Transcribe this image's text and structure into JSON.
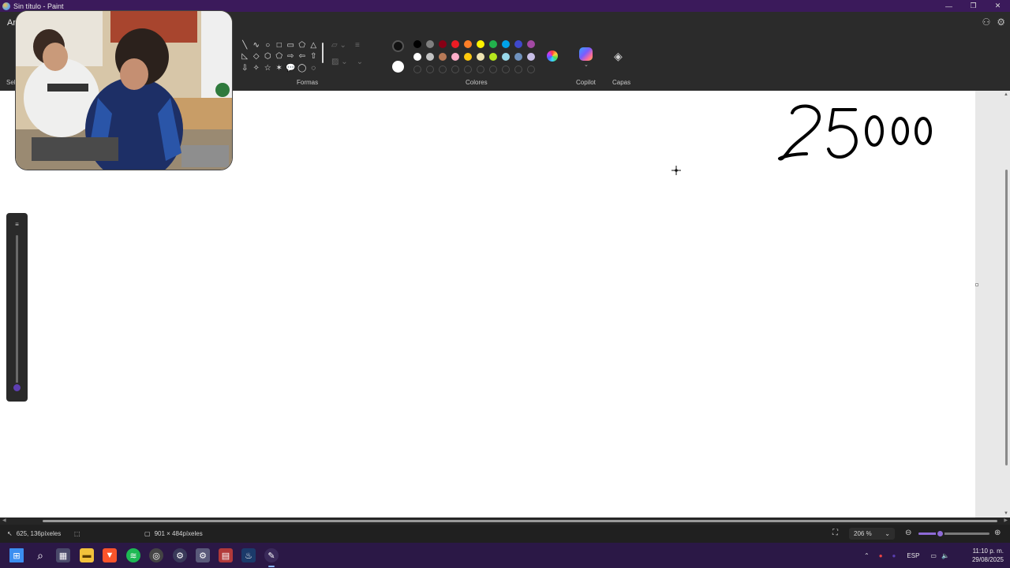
{
  "window": {
    "title": "Sin título - Paint",
    "controls": {
      "minimize": "—",
      "maximize": "❐",
      "close": "✕"
    }
  },
  "menu": {
    "file_label": "Arch",
    "icons": [
      "copilot-account-icon",
      "settings-icon"
    ]
  },
  "ribbon": {
    "select_label": "Sel",
    "shapes_label": "Formas",
    "colors_label": "Colores",
    "copilot_label": "Copilot",
    "layers_label": "Capas",
    "shapes": [
      "╲",
      "∿",
      "○",
      "□",
      "▭",
      "⬠",
      "△",
      "◺",
      "◇",
      "⬡",
      "⬠",
      "⇨",
      "⇦",
      "⇧",
      "⇩",
      "✧",
      "☆",
      "✶",
      "💬",
      "◯",
      "◌"
    ],
    "primary_color": "#111111",
    "secondary_color": "#ffffff",
    "palette_row1": [
      "#000000",
      "#7f7f7f",
      "#880015",
      "#ed1c24",
      "#ff7f27",
      "#fff200",
      "#22b14c",
      "#00a2e8",
      "#3f48cc",
      "#a349a4"
    ],
    "palette_row2": [
      "#ffffff",
      "#c3c3c3",
      "#b97a57",
      "#ffaec9",
      "#ffc90e",
      "#efe4b0",
      "#b5e61d",
      "#99d9ea",
      "#7092be",
      "#c8bfe7"
    ]
  },
  "canvas": {
    "drawn_text": "25000",
    "background": "#ffffff"
  },
  "status": {
    "cursor_position": "625, 136píxeles",
    "canvas_size": "901 × 484píxeles",
    "zoom": "206 %"
  },
  "taskbar": {
    "apps": [
      "start-icon",
      "search-icon",
      "store-icon",
      "file-explorer-icon",
      "brave-icon",
      "spotify-icon",
      "chrome-icon",
      "steam-icon",
      "settings-icon",
      "app-icon",
      "steam-client-icon",
      "paint-icon"
    ],
    "tray": {
      "language": "ESP",
      "time": "11:10 p. m.",
      "date": "29/08/2025"
    }
  }
}
